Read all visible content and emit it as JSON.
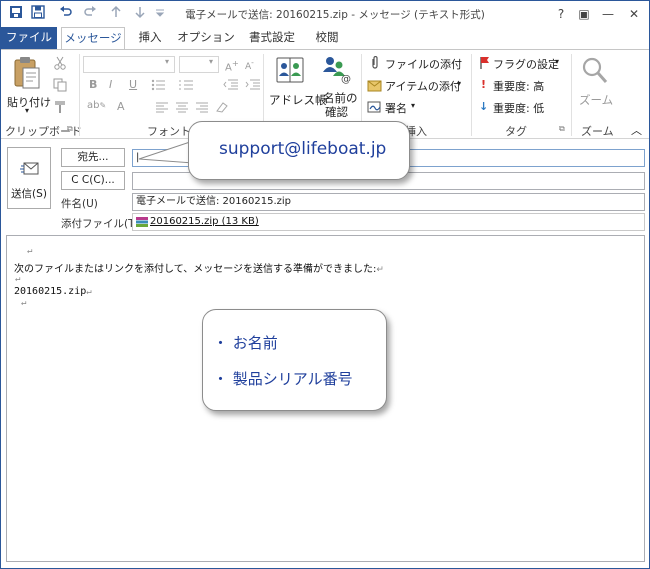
{
  "window": {
    "title": "電子メールで送信: 20160215.zip - メッセージ (テキスト形式)",
    "help": "?",
    "controls": [
      "▣",
      "—",
      "☐",
      "✕"
    ]
  },
  "tabs": [
    "ファイル",
    "メッセージ",
    "挿入",
    "オプション",
    "書式設定",
    "校閲"
  ],
  "ribbon": {
    "paste_label": "貼り付け",
    "clipboard_label": "クリップボード",
    "font_label": "フォント",
    "address_book_label": "アドレス帳",
    "check_names_line1": "名前の",
    "check_names_line2": "確認",
    "include_label": "挿入",
    "attach_file": "ファイルの添付",
    "attach_item": "アイテムの添付",
    "signature": "署名",
    "follow_up": "フラグの設定",
    "high_importance": "重要度: 高",
    "low_importance": "重要度: 低",
    "tags_label": "タグ",
    "zoom_button": "ズーム",
    "zoom_label": "ズーム",
    "font_buttons": [
      "B",
      "I",
      "U"
    ]
  },
  "header": {
    "send_label": "送信(S)",
    "to_button": "宛先...",
    "cc_button": "C C(C)...",
    "to_value": "|",
    "cc_value": "",
    "subject_label": "件名(U)",
    "subject_value": "電子メールで送信: 20160215.zip",
    "attach_label": "添付ファイル(T)",
    "attachment": "20160215.zip (13 KB)"
  },
  "body": {
    "line1": "次のファイルまたはリンクを添付して、メッセージを送信する準備ができました:",
    "line2": "20160215.zip",
    "para_mark": "↵"
  },
  "callouts": {
    "email": "support@lifeboat.jp",
    "bullet1": "・ お名前",
    "bullet2": "・ 製品シリアル番号"
  }
}
